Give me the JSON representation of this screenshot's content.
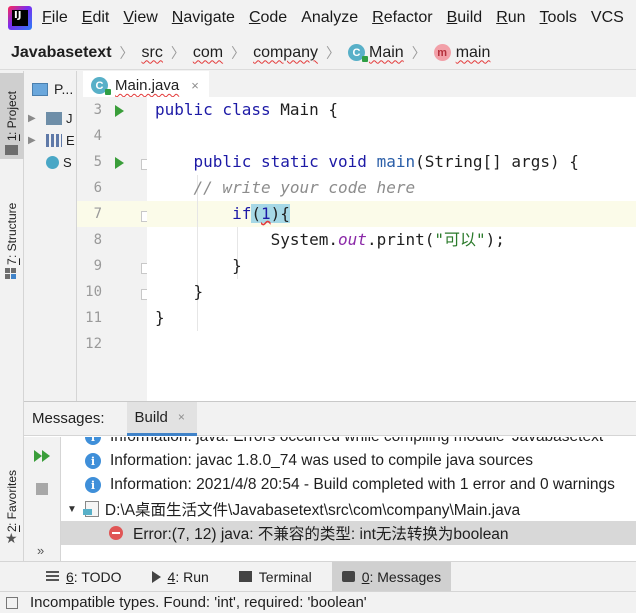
{
  "menubar": {
    "logo_text": "IJ",
    "items": [
      {
        "mnemonic": "F",
        "rest": "ile"
      },
      {
        "mnemonic": "E",
        "rest": "dit"
      },
      {
        "mnemonic": "V",
        "rest": "iew"
      },
      {
        "mnemonic": "N",
        "rest": "avigate"
      },
      {
        "mnemonic": "C",
        "rest": "ode"
      },
      {
        "mnemonic": "",
        "rest": "Analyze"
      },
      {
        "mnemonic": "R",
        "rest": "efactor"
      },
      {
        "mnemonic": "B",
        "rest": "uild"
      },
      {
        "mnemonic": "R",
        "rest": "un"
      },
      {
        "mnemonic": "T",
        "rest": "ools"
      },
      {
        "mnemonic": "",
        "rest": "VCS"
      }
    ]
  },
  "breadcrumb": {
    "project": "Javabasetext",
    "items": [
      "src",
      "com",
      "company",
      "Main",
      "main"
    ],
    "class_icon_letter": "C",
    "method_icon_letter": "m"
  },
  "left_strip": {
    "project_tab_num": "1",
    "project_tab_label": ": Project",
    "structure_tab_num": "7",
    "structure_tab_label": ": Structure",
    "favorites_tab_num": "2",
    "favorites_tab_label": ": Favorites"
  },
  "project_panel": {
    "header": "P...",
    "rows": [
      {
        "arrow": "▶",
        "label": "J"
      },
      {
        "arrow": "▶",
        "label": "E"
      },
      {
        "arrow": "",
        "label": "S"
      }
    ]
  },
  "editor": {
    "tab_label": "Main.java",
    "tab_close": "×",
    "lines": [
      3,
      4,
      5,
      6,
      7,
      8,
      9,
      10,
      11,
      12
    ],
    "code": {
      "l3_kw": "public class",
      "l3_rest": " Main {",
      "l5_kw": "public static void",
      "l5_fn": "main",
      "l5_rest": "(String[] args) {",
      "l6_comment": "// write your code here",
      "l7_kw": "if",
      "l7_open": "(",
      "l7_num": "1",
      "l7_close": "){",
      "l8_a": "System.",
      "l8_field": "out",
      "l8_b": ".print(",
      "l8_str": "\"可以\"",
      "l8_c": ");",
      "l9": "}",
      "l10": "}",
      "l11": "}"
    }
  },
  "messages": {
    "label": "Messages:",
    "build_tab": "Build",
    "build_close": "×",
    "info_icon": "i",
    "rows": [
      "Information: java: Errors occurred while compiling module 'Javabasetext'",
      "Information: javac 1.8.0_74 was used to compile java sources",
      "Information: 2021/4/8 20:54 - Build completed with 1 error and 0 warnings"
    ],
    "file_path": "D:\\A桌面生活文件\\Javabasetext\\src\\com\\company\\Main.java",
    "error": "Error:(7, 12)  java: 不兼容的类型: int无法转换为boolean",
    "expander": "»"
  },
  "bottom_bar": {
    "tabs": [
      {
        "num": "6",
        "label": ": TODO"
      },
      {
        "num": "4",
        "label": ": Run"
      },
      {
        "num": "",
        "label": "Terminal"
      },
      {
        "num": "0",
        "label": ": Messages"
      }
    ]
  },
  "status_bar": {
    "text": "Incompatible types. Found: 'int', required: 'boolean'"
  },
  "colors": {
    "accent": "#4083c9",
    "run_green": "#3a9e3a",
    "error_red": "#e05555",
    "keyword": "#1d1aa6"
  }
}
